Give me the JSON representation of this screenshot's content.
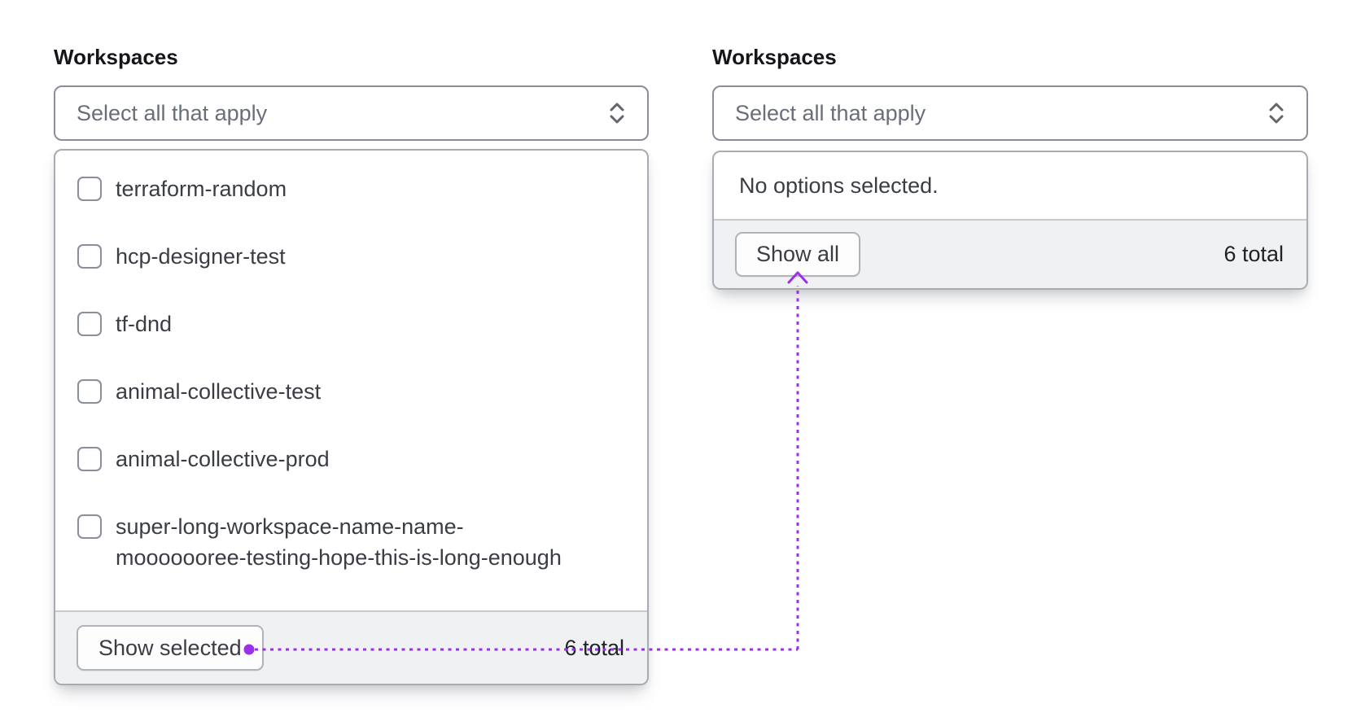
{
  "annotation": {
    "color": "#9b30e8",
    "meaning": "links show-selected-button state to show-all-button state"
  },
  "left_select": {
    "label": "Workspaces",
    "trigger": {
      "placeholder": "Select all that apply",
      "icon": "caret-double-icon"
    },
    "options": [
      "terraform-random",
      "hcp-designer-test",
      "tf-dnd",
      "animal-collective-test",
      "animal-collective-prod",
      "super-long-workspace-name-name-mooooooree-testing-hope-this-is-long-enough"
    ],
    "footer": {
      "button_label": "Show selected",
      "total": "6 total"
    }
  },
  "right_select": {
    "label": "Workspaces",
    "trigger": {
      "placeholder": "Select all that apply",
      "icon": "caret-double-icon"
    },
    "empty_message": "No options selected.",
    "footer": {
      "button_label": "Show all",
      "total": "6 total"
    }
  }
}
